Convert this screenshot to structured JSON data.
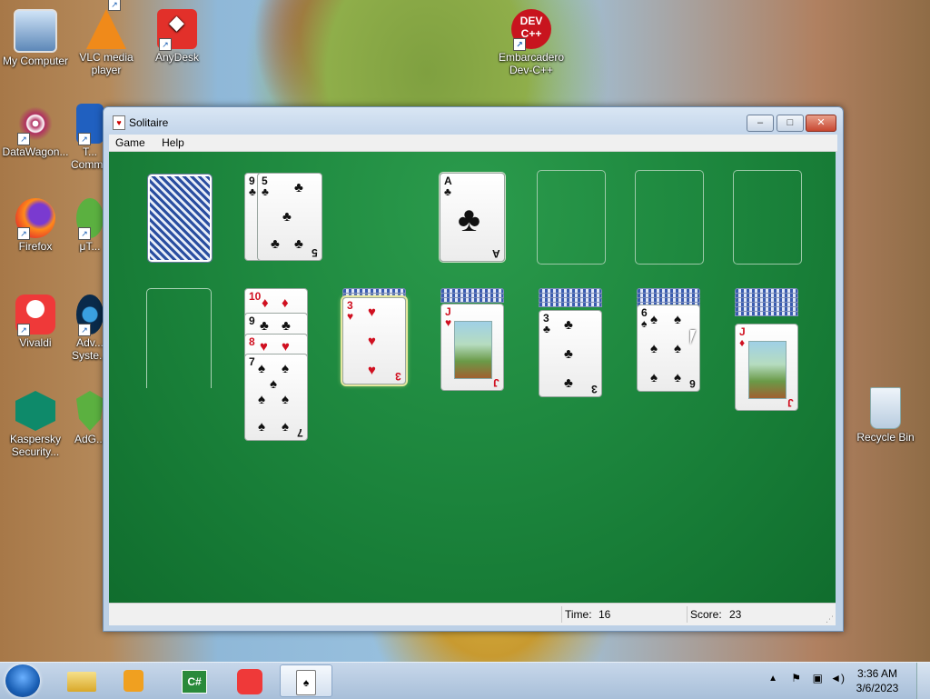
{
  "desktop": {
    "icons": [
      {
        "label": "My Computer",
        "name": "my-computer-icon"
      },
      {
        "label": "VLC media player",
        "name": "vlc-icon"
      },
      {
        "label": "AnyDesk",
        "name": "anydesk-icon"
      },
      {
        "label": "Embarcadero Dev-C++",
        "name": "devcpp-icon",
        "logo_text": "DEV C++"
      },
      {
        "label": "DataWagon...",
        "name": "datawagon-icon"
      },
      {
        "label": "Firefox",
        "name": "firefox-icon"
      },
      {
        "label": "Vivaldi",
        "name": "vivaldi-icon"
      },
      {
        "label": "Kaspersky Security...",
        "name": "kaspersky-icon"
      },
      {
        "label": "Recycle Bin",
        "name": "recycle-bin-icon"
      },
      {
        "label": "T... Comm...",
        "name": "total-commander-icon"
      },
      {
        "label": "μT...",
        "name": "utorrent-icon"
      },
      {
        "label": "Adv... Syste...",
        "name": "advanced-systemcare-icon"
      },
      {
        "label": "AdG...",
        "name": "adguard-icon"
      }
    ]
  },
  "window": {
    "title": "Solitaire",
    "menu": [
      "Game",
      "Help"
    ],
    "controls": {
      "minimize": "–",
      "maximize": "□",
      "close": "✕"
    }
  },
  "game": {
    "stock": {
      "state": "face-down"
    },
    "waste": [
      {
        "rank": "9",
        "suit": "♣",
        "color": "black"
      },
      {
        "rank": "5",
        "suit": "♣",
        "color": "black"
      }
    ],
    "foundations": [
      {
        "rank": "A",
        "suit": "♣",
        "color": "black"
      },
      null,
      null,
      null
    ],
    "tableau": [
      {
        "hidden": 0,
        "cards": []
      },
      {
        "hidden": 0,
        "cards": [
          {
            "rank": "10",
            "suit": "♦",
            "color": "red"
          },
          {
            "rank": "9",
            "suit": "♣",
            "color": "black"
          },
          {
            "rank": "8",
            "suit": "♥",
            "color": "red"
          },
          {
            "rank": "7",
            "suit": "♠",
            "color": "black"
          }
        ]
      },
      {
        "hidden": 2,
        "cards": [
          {
            "rank": "3",
            "suit": "♥",
            "color": "red",
            "selected": true
          }
        ]
      },
      {
        "hidden": 3,
        "cards": [
          {
            "rank": "J",
            "suit": "♥",
            "color": "red"
          }
        ]
      },
      {
        "hidden": 4,
        "cards": [
          {
            "rank": "3",
            "suit": "♣",
            "color": "black"
          }
        ]
      },
      {
        "hidden": 5,
        "cards": [
          {
            "rank": "6",
            "suit": "♠",
            "color": "black"
          }
        ]
      },
      {
        "hidden": 6,
        "cards": [
          {
            "rank": "J",
            "suit": "♦",
            "color": "red"
          }
        ]
      }
    ]
  },
  "status": {
    "time_label": "Time:",
    "time_value": "16",
    "score_label": "Score:",
    "score_value": "23"
  },
  "taskbar": {
    "pinned": [
      "explorer-icon",
      "media-player-icon",
      "csharp-icon",
      "vivaldi-icon",
      "solitaire-icon"
    ],
    "csharp_text": "C#",
    "clock_time": "3:36 AM",
    "clock_date": "3/6/2023"
  }
}
